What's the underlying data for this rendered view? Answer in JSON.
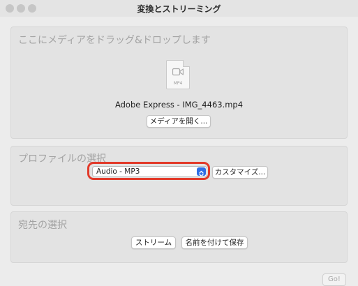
{
  "window": {
    "title": "変換とストリーミング"
  },
  "drop_panel": {
    "heading": "ここにメディアをドラッグ&ドロップします",
    "file_type": "MP4",
    "file_name": "Adobe Express - IMG_4463.mp4",
    "open_button": "メディアを開く..."
  },
  "profile_panel": {
    "heading": "プロファイルの選択",
    "selected_profile": "Audio - MP3",
    "customize_button": "カスタマイズ...",
    "highlight_color": "#e23a2a",
    "accent_color": "#2f6fe6"
  },
  "destination_panel": {
    "heading": "宛先の選択",
    "stream_button": "ストリーム",
    "save_button": "名前を付けて保存"
  },
  "footer": {
    "go_button": "Go!"
  }
}
